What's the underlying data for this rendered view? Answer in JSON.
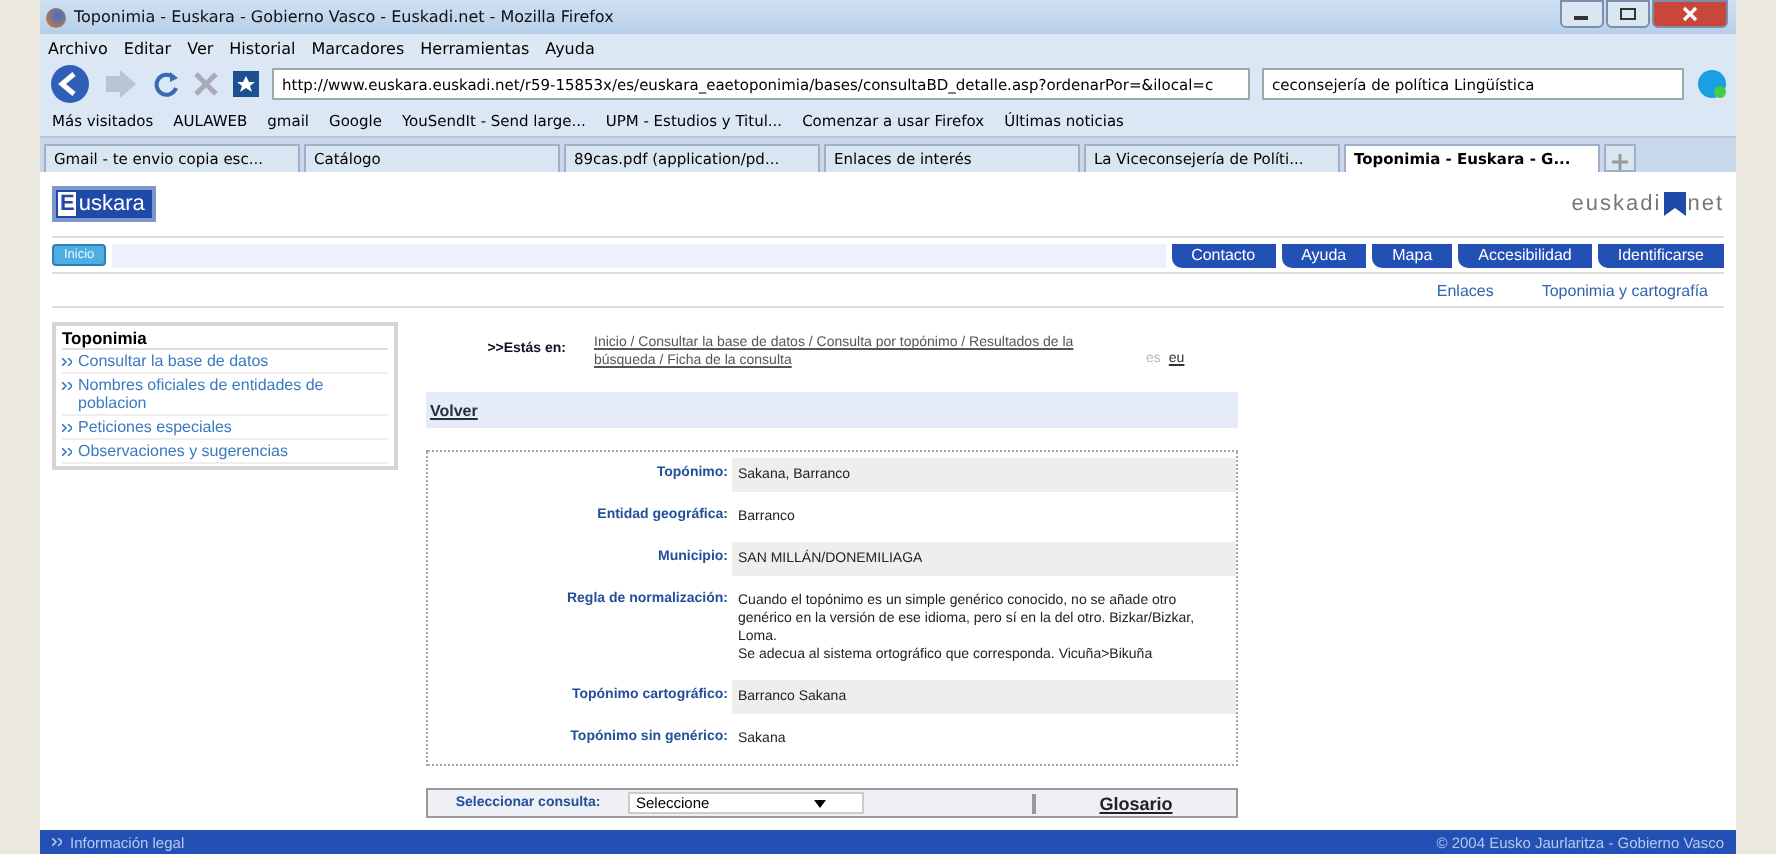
{
  "window": {
    "title": "Toponimia - Euskara - Gobierno Vasco - Euskadi.net - Mozilla Firefox"
  },
  "menu": [
    "Archivo",
    "Editar",
    "Ver",
    "Historial",
    "Marcadores",
    "Herramientas",
    "Ayuda"
  ],
  "toolbar": {
    "url": "http://www.euskara.euskadi.net/r59-15853x/es/euskara_eaetoponimia/bases/consultaBD_detalle.asp?ordenarPor=&ilocal=c",
    "search": "ceconsejería de política Lingüística"
  },
  "bookmarks": [
    "Más visitados",
    "AULAWEB",
    "gmail",
    "Google",
    "YouSendIt - Send large...",
    "UPM - Estudios y Titul...",
    "Comenzar a usar Firefox",
    "Últimas noticias"
  ],
  "tabs": [
    {
      "label": "Gmail - te envio copia esc...",
      "selected": false
    },
    {
      "label": "Catálogo",
      "selected": false
    },
    {
      "label": "89cas.pdf (application/pd...",
      "selected": false
    },
    {
      "label": "Enlaces de interés",
      "selected": false
    },
    {
      "label": "La Viceconsejería de Políti...",
      "selected": false
    },
    {
      "label": "Toponimia - Euskara - G...",
      "selected": true
    }
  ],
  "page": {
    "logo": "Euskara",
    "brand": [
      "euskadi",
      "net"
    ],
    "home": "Inicio",
    "nav_buttons": [
      "Contacto",
      "Ayuda",
      "Mapa",
      "Accesibilidad",
      "Identificarse"
    ],
    "sublinks": [
      "Enlaces",
      "Toponimia y cartografía"
    ],
    "sidebar": {
      "title": "Toponimia",
      "items": [
        "Consultar la base de datos",
        "Nombres oficiales de entidades de poblacion",
        "Peticiones especiales",
        "Observaciones y sugerencias"
      ]
    },
    "breadcrumb": {
      "label": ">>Estás en:",
      "path": "Inicio / Consultar la base de datos / Consulta por topónimo / Resultados de la búsqueda / Ficha de la consulta"
    },
    "languages": [
      {
        "label": "es",
        "selected": true
      },
      {
        "label": "eu",
        "selected": false
      }
    ],
    "back": "Volver",
    "fields": [
      {
        "label": "Topónimo:",
        "value": "Sakana, Barranco"
      },
      {
        "label": "Entidad geográfica:",
        "value": "Barranco"
      },
      {
        "label": "Municipio:",
        "value": "SAN MILLÁN/DONEMILIAGA"
      },
      {
        "label": "Regla de normalización:",
        "value": "Cuando el topónimo es un simple genérico conocido, no se añade otro genérico en la versión de ese idioma, pero sí en la del otro. Bizkar/Bizkar, Loma.\n Se adecua al sistema ortográfico que corresponda. Vicuña>Bikuña"
      },
      {
        "label": "Topónimo cartográfico:",
        "value": "Barranco Sakana"
      },
      {
        "label": "Topónimo sin genérico:",
        "value": "Sakana"
      }
    ],
    "query": {
      "label": "Seleccionar consulta:",
      "value": "Seleccione",
      "glossary": "Glosario"
    },
    "footer": {
      "left": "Información legal",
      "right": "© 2004 Eusko Jaurlaritza - Gobierno Vasco"
    }
  }
}
